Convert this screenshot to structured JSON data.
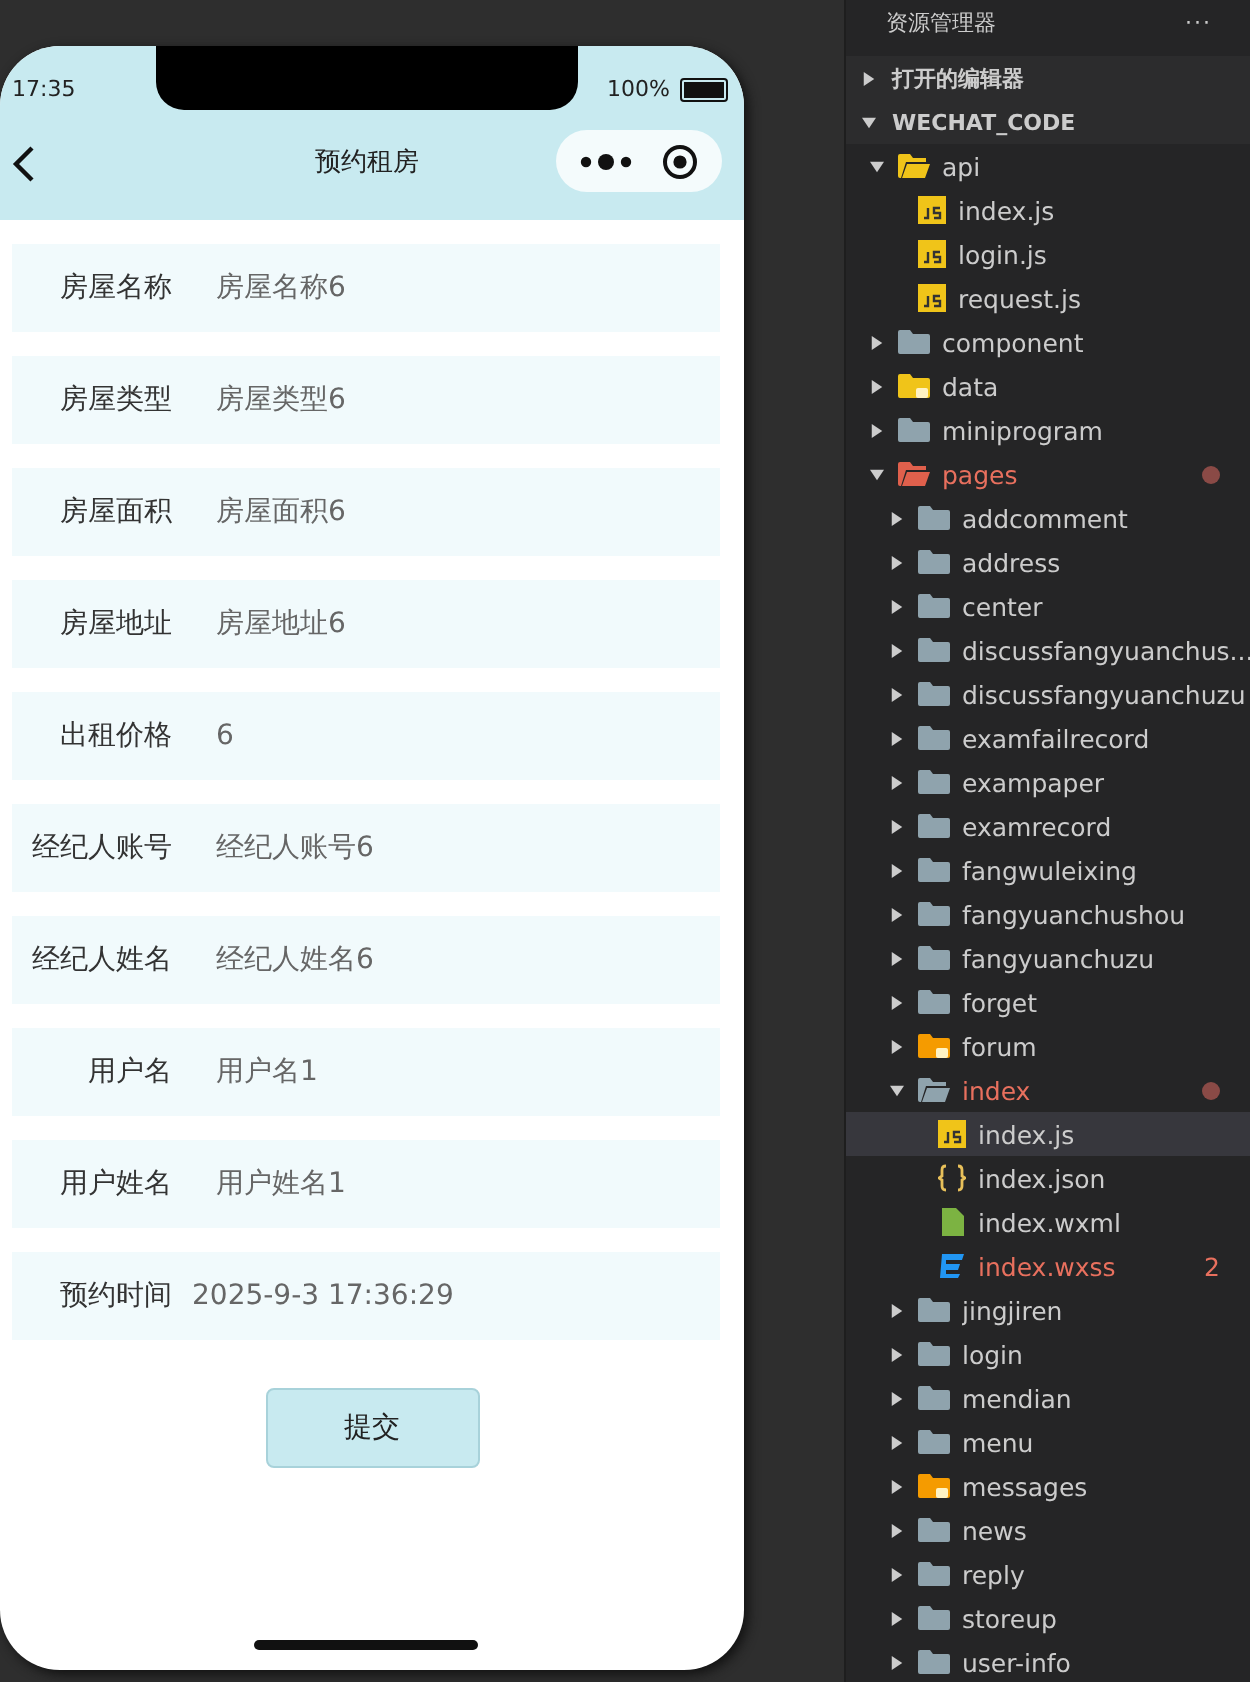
{
  "phone": {
    "time": "17:35",
    "battery": "100%",
    "title": "预约租房",
    "fields": [
      {
        "label": "房屋名称",
        "value": "房屋名称6",
        "kind": "input"
      },
      {
        "label": "房屋类型",
        "value": "房屋类型6",
        "kind": "input"
      },
      {
        "label": "房屋面积",
        "value": "房屋面积6",
        "kind": "input"
      },
      {
        "label": "房屋地址",
        "value": "房屋地址6",
        "kind": "input"
      },
      {
        "label": "出租价格",
        "value": "6",
        "kind": "input"
      },
      {
        "label": "经纪人账号",
        "value": "经纪人账号6",
        "kind": "input"
      },
      {
        "label": "经纪人姓名",
        "value": "经纪人姓名6",
        "kind": "input"
      },
      {
        "label": "用户名",
        "value": "用户名1",
        "kind": "input"
      },
      {
        "label": "用户姓名",
        "value": "用户姓名1",
        "kind": "input"
      },
      {
        "label": "预约时间",
        "value": "2025-9-3 17:36:29",
        "kind": "picker"
      }
    ],
    "submit": "提交"
  },
  "explorer": {
    "title": "资源管理器",
    "more": "···",
    "sections": [
      {
        "label": "打开的编辑器",
        "expanded": false
      },
      {
        "label": "WECHAT_CODE",
        "expanded": true,
        "children": [
          {
            "label": "api",
            "kind": "code-folder",
            "expanded": true,
            "selected": false,
            "modified": false,
            "children": [
              {
                "label": "index.js",
                "kind": "js",
                "selected": false,
                "modified": false
              },
              {
                "label": "login.js",
                "kind": "js",
                "selected": false,
                "modified": false
              },
              {
                "label": "request.js",
                "kind": "js",
                "selected": false,
                "modified": false
              }
            ]
          },
          {
            "label": "component",
            "kind": "folder",
            "expanded": false,
            "selected": false,
            "modified": false
          },
          {
            "label": "data",
            "kind": "data-folder",
            "expanded": false,
            "selected": false,
            "modified": false
          },
          {
            "label": "miniprogram",
            "kind": "folder",
            "expanded": false,
            "selected": false,
            "modified": false
          },
          {
            "label": "pages",
            "kind": "page-folder",
            "expanded": true,
            "selected": false,
            "modified": true,
            "children": [
              {
                "label": "addcomment",
                "kind": "folder",
                "expanded": false,
                "selected": false,
                "modified": false
              },
              {
                "label": "address",
                "kind": "folder",
                "expanded": false,
                "selected": false,
                "modified": false
              },
              {
                "label": "center",
                "kind": "folder",
                "expanded": false,
                "selected": false,
                "modified": false
              },
              {
                "label": "discussfangyuanchus...",
                "kind": "folder",
                "expanded": false,
                "selected": false,
                "modified": false
              },
              {
                "label": "discussfangyuanchuzu",
                "kind": "folder",
                "expanded": false,
                "selected": false,
                "modified": false
              },
              {
                "label": "examfailrecord",
                "kind": "folder",
                "expanded": false,
                "selected": false,
                "modified": false
              },
              {
                "label": "exampaper",
                "kind": "folder",
                "expanded": false,
                "selected": false,
                "modified": false
              },
              {
                "label": "examrecord",
                "kind": "folder",
                "expanded": false,
                "selected": false,
                "modified": false
              },
              {
                "label": "fangwuleixing",
                "kind": "folder",
                "expanded": false,
                "selected": false,
                "modified": false
              },
              {
                "label": "fangyuanchushou",
                "kind": "folder",
                "expanded": false,
                "selected": false,
                "modified": false
              },
              {
                "label": "fangyuanchuzu",
                "kind": "folder",
                "expanded": false,
                "selected": false,
                "modified": false
              },
              {
                "label": "forget",
                "kind": "folder",
                "expanded": false,
                "selected": false,
                "modified": false
              },
              {
                "label": "forum",
                "kind": "chat-folder",
                "expanded": false,
                "selected": false,
                "modified": false
              },
              {
                "label": "index",
                "kind": "folder",
                "expanded": true,
                "selected": false,
                "modified": true,
                "children": [
                  {
                    "label": "index.js",
                    "kind": "js",
                    "selected": true,
                    "modified": false
                  },
                  {
                    "label": "index.json",
                    "kind": "json",
                    "selected": false,
                    "modified": false
                  },
                  {
                    "label": "index.wxml",
                    "kind": "wxml",
                    "selected": false,
                    "modified": false
                  },
                  {
                    "label": "index.wxss",
                    "kind": "wxss",
                    "selected": false,
                    "modified": true,
                    "problems": "2"
                  }
                ]
              },
              {
                "label": "jingjiren",
                "kind": "folder",
                "expanded": false,
                "selected": false,
                "modified": false
              },
              {
                "label": "login",
                "kind": "folder",
                "expanded": false,
                "selected": false,
                "modified": false
              },
              {
                "label": "mendian",
                "kind": "folder",
                "expanded": false,
                "selected": false,
                "modified": false
              },
              {
                "label": "menu",
                "kind": "folder",
                "expanded": false,
                "selected": false,
                "modified": false
              },
              {
                "label": "messages",
                "kind": "chat-folder",
                "expanded": false,
                "selected": false,
                "modified": false
              },
              {
                "label": "news",
                "kind": "folder",
                "expanded": false,
                "selected": false,
                "modified": false
              },
              {
                "label": "reply",
                "kind": "folder",
                "expanded": false,
                "selected": false,
                "modified": false
              },
              {
                "label": "storeup",
                "kind": "folder",
                "expanded": false,
                "selected": false,
                "modified": false
              },
              {
                "label": "user-info",
                "kind": "folder",
                "expanded": false,
                "selected": false,
                "modified": false
              }
            ]
          }
        ]
      }
    ]
  }
}
